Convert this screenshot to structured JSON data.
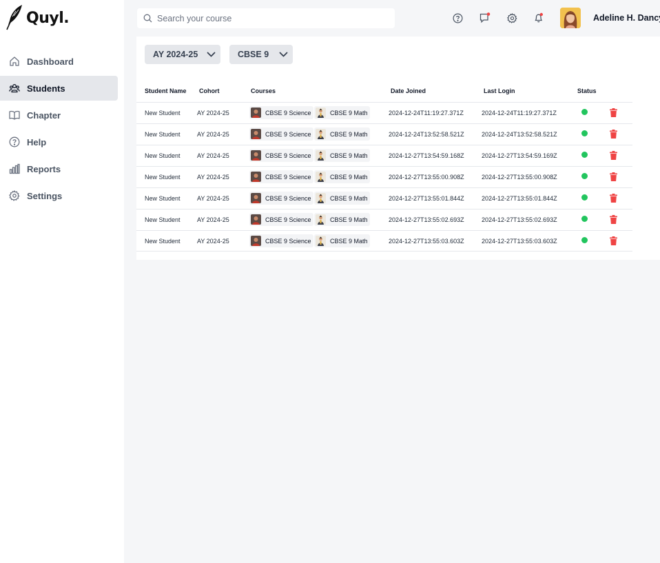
{
  "app": {
    "logo_text": "Quyl."
  },
  "sidebar": {
    "items": [
      {
        "label": "Dashboard",
        "icon": "home-icon",
        "active": false
      },
      {
        "label": "Students",
        "icon": "users-icon",
        "active": true
      },
      {
        "label": "Chapter",
        "icon": "book-icon",
        "active": false
      },
      {
        "label": "Help",
        "icon": "help-circle-icon",
        "active": false
      },
      {
        "label": "Reports",
        "icon": "bar-chart-icon",
        "active": false
      },
      {
        "label": "Settings",
        "icon": "gear-icon",
        "active": false
      }
    ]
  },
  "header": {
    "search_placeholder": "Search your course",
    "icons": [
      "help-circle-icon",
      "message-icon",
      "gear-icon",
      "bell-icon"
    ],
    "user_name": "Adeline H. Dancy"
  },
  "filters": {
    "year": "AY 2024-25",
    "grade": "CBSE 9"
  },
  "table": {
    "columns": [
      "Student Name",
      "Cohort",
      "Courses",
      "Date Joined",
      "Last Login",
      "Status"
    ],
    "rows": [
      {
        "name": "New Student",
        "cohort": "AY 2024-25",
        "course1": "CBSE 9 Science",
        "course2": "CBSE 9 Math",
        "date_joined": "2024-12-24T11:19:27.371Z",
        "last_login": "2024-12-24T11:19:27.371Z",
        "status": "active"
      },
      {
        "name": "New Student",
        "cohort": "AY 2024-25",
        "course1": "CBSE 9 Science",
        "course2": "CBSE 9 Math",
        "date_joined": "2024-12-24T13:52:58.521Z",
        "last_login": "2024-12-24T13:52:58.521Z",
        "status": "active"
      },
      {
        "name": "New Student",
        "cohort": "AY 2024-25",
        "course1": "CBSE 9 Science",
        "course2": "CBSE 9 Math",
        "date_joined": "2024-12-27T13:54:59.168Z",
        "last_login": "2024-12-27T13:54:59.169Z",
        "status": "active"
      },
      {
        "name": "New Student",
        "cohort": "AY 2024-25",
        "course1": "CBSE 9 Science",
        "course2": "CBSE 9 Math",
        "date_joined": "2024-12-27T13:55:00.908Z",
        "last_login": "2024-12-27T13:55:00.908Z",
        "status": "active"
      },
      {
        "name": "New Student",
        "cohort": "AY 2024-25",
        "course1": "CBSE 9 Science",
        "course2": "CBSE 9 Math",
        "date_joined": "2024-12-27T13:55:01.844Z",
        "last_login": "2024-12-27T13:55:01.844Z",
        "status": "active"
      },
      {
        "name": "New Student",
        "cohort": "AY 2024-25",
        "course1": "CBSE 9 Science",
        "course2": "CBSE 9 Math",
        "date_joined": "2024-12-27T13:55:02.693Z",
        "last_login": "2024-12-27T13:55:02.693Z",
        "status": "active"
      },
      {
        "name": "New Student",
        "cohort": "AY 2024-25",
        "course1": "CBSE 9 Science",
        "course2": "CBSE 9 Math",
        "date_joined": "2024-12-27T13:55:03.603Z",
        "last_login": "2024-12-27T13:55:03.603Z",
        "status": "active"
      }
    ]
  },
  "colors": {
    "status_active": "#22c55e",
    "delete": "#ef4444",
    "notification_dot": "#ef4444",
    "sidebar_active_bg": "#e5e7eb"
  }
}
